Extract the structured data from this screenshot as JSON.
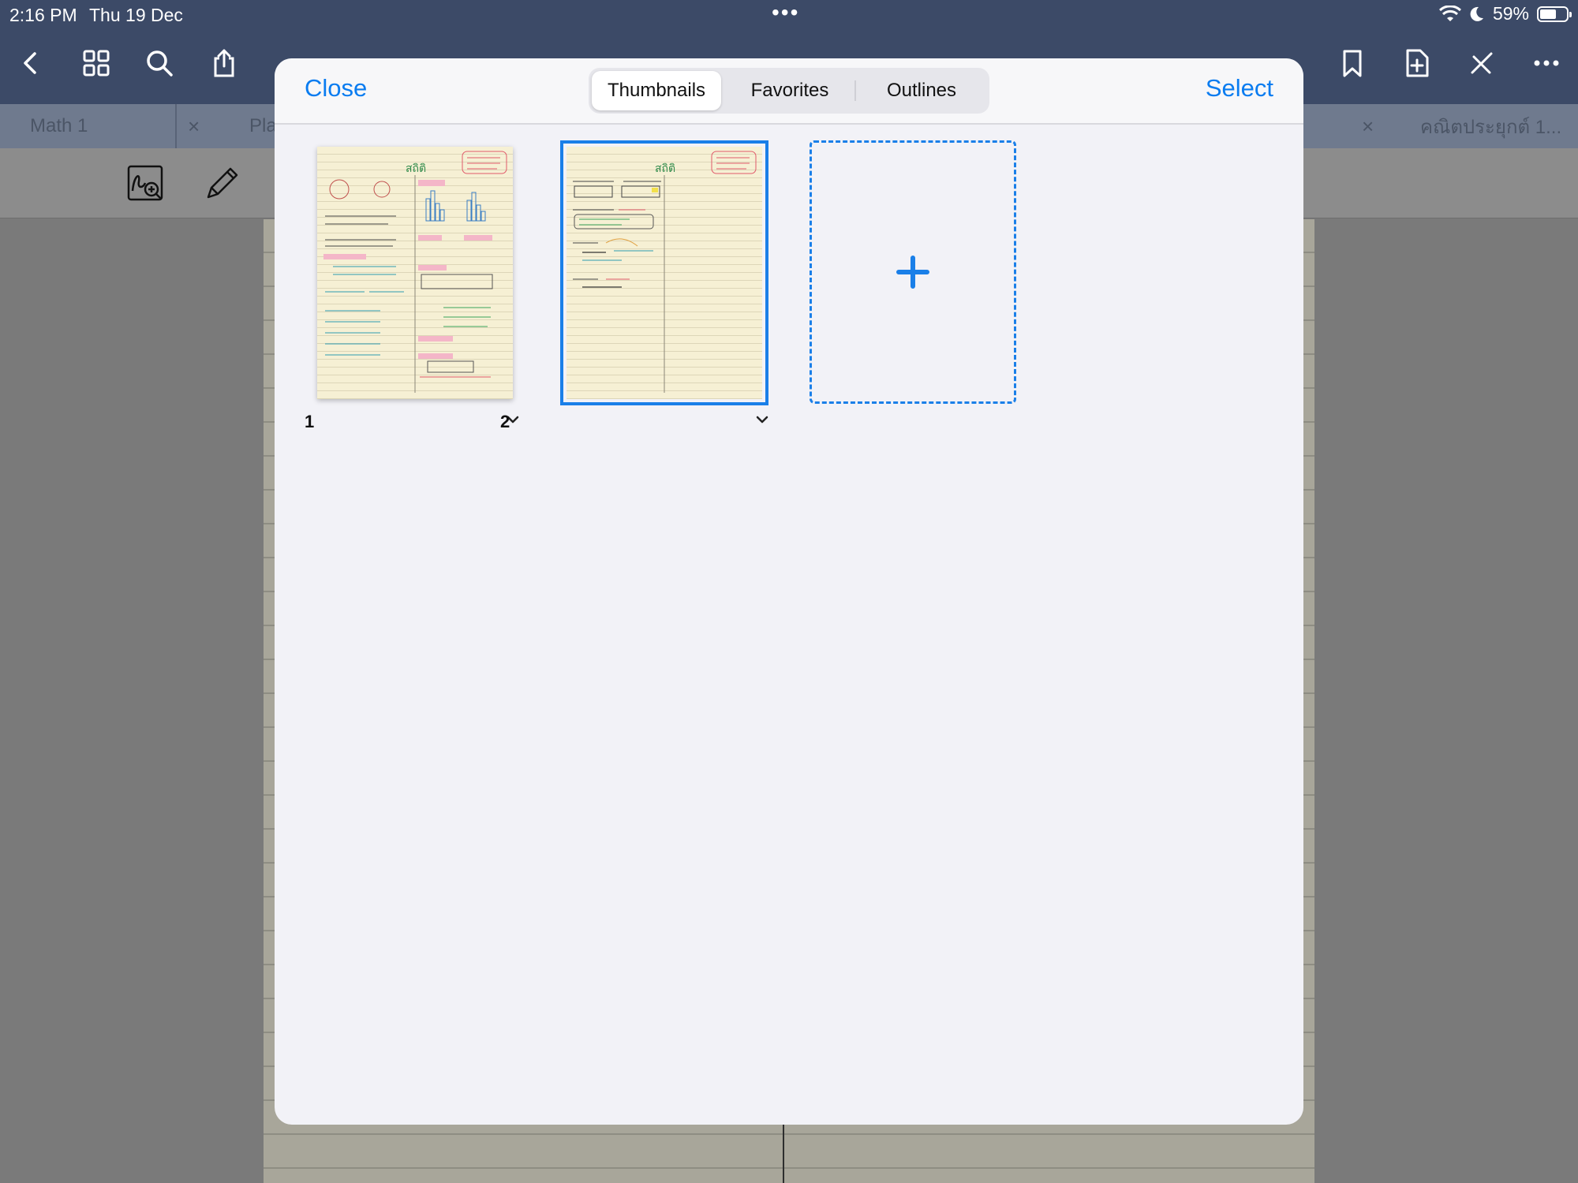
{
  "status_bar": {
    "time": "2:16 PM",
    "date": "Thu 19 Dec",
    "battery": "59%",
    "battery_level": 0.59
  },
  "toolbar": {
    "icons": [
      "back-icon",
      "grid-icon",
      "search-icon",
      "share-icon",
      "bookmark-icon",
      "add-page-icon",
      "close-tools-icon",
      "more-icon"
    ]
  },
  "tabs": {
    "items": [
      {
        "label": "Math 1"
      },
      {
        "label": "Pla"
      },
      {
        "label": "คณิตประยุกต์ 1..."
      }
    ]
  },
  "sheet": {
    "close_label": "Close",
    "select_label": "Select",
    "segments": [
      {
        "label": "Thumbnails",
        "active": true
      },
      {
        "label": "Favorites",
        "active": false
      },
      {
        "label": "Outlines",
        "active": false
      }
    ],
    "pages": [
      {
        "number": "1",
        "title": "สถิติ",
        "selected": false
      },
      {
        "number": "2",
        "title": "สถิติ",
        "selected": true
      }
    ],
    "accent_color": "#0a7cf0"
  }
}
